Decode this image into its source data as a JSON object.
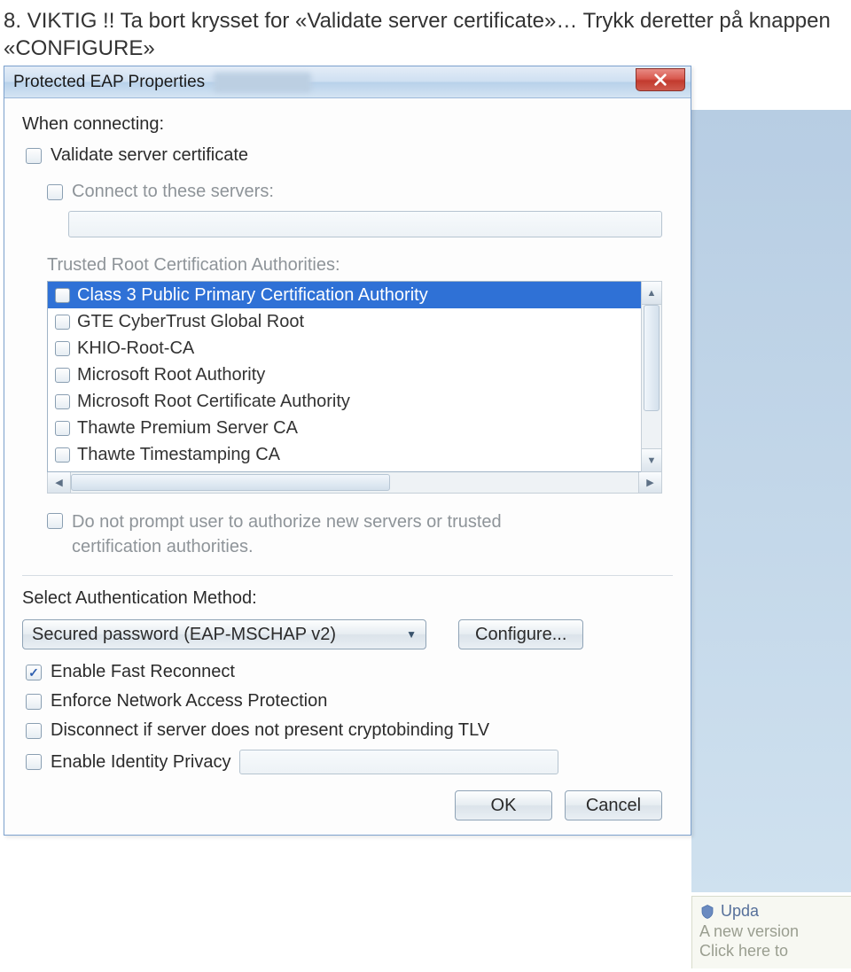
{
  "instruction": "8. VIKTIG !! Ta bort krysset for «Validate server certificate»… Trykk deretter på knappen «CONFIGURE»",
  "dialog": {
    "title": "Protected EAP Properties",
    "when_connecting_label": "When connecting:",
    "validate_label": "Validate server certificate",
    "connect_servers_label": "Connect to these servers:",
    "connect_servers_value": "",
    "trusted_label": "Trusted Root Certification Authorities:",
    "authorities": [
      {
        "label": "Class 3 Public Primary Certification Authority",
        "selected": true
      },
      {
        "label": "GTE CyberTrust Global Root",
        "selected": false
      },
      {
        "label": "KHIO-Root-CA",
        "selected": false
      },
      {
        "label": "Microsoft Root Authority",
        "selected": false
      },
      {
        "label": "Microsoft Root Certificate Authority",
        "selected": false
      },
      {
        "label": "Thawte Premium Server CA",
        "selected": false
      },
      {
        "label": "Thawte Timestamping CA",
        "selected": false
      }
    ],
    "no_prompt_label": "Do not prompt user to authorize new servers or trusted certification authorities.",
    "auth_method_label": "Select Authentication Method:",
    "auth_method_value": "Secured password (EAP-MSCHAP v2)",
    "configure_button": "Configure...",
    "options": {
      "fast_reconnect": {
        "label": "Enable Fast Reconnect",
        "checked": true
      },
      "nap": {
        "label": "Enforce Network Access Protection",
        "checked": false
      },
      "cryptobinding": {
        "label": "Disconnect if server does not present cryptobinding TLV",
        "checked": false
      },
      "identity_privacy": {
        "label": "Enable Identity Privacy",
        "checked": false,
        "value": ""
      }
    },
    "ok_button": "OK",
    "cancel_button": "Cancel"
  },
  "behind": {
    "title": "Upda",
    "line1": "A new version",
    "line2": "Click here to"
  }
}
